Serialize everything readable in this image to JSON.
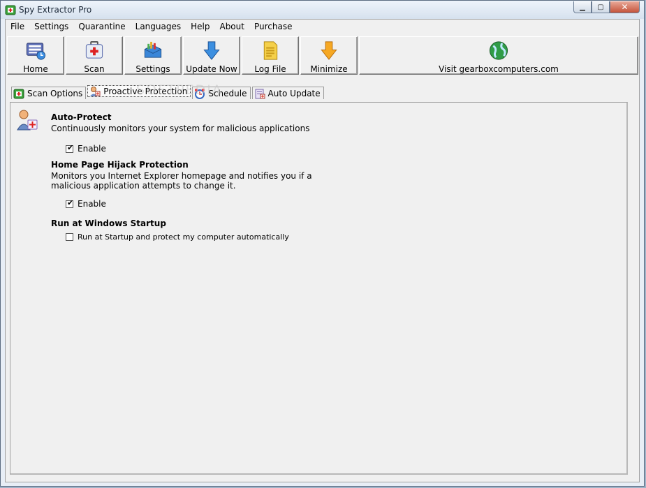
{
  "window": {
    "title": "Spy Extractor Pro",
    "controls": [
      "minimize",
      "maximize",
      "close"
    ]
  },
  "menu": [
    "File",
    "Settings",
    "Quarantine",
    "Languages",
    "Help",
    "About",
    "Purchase"
  ],
  "toolbar": {
    "home": "Home",
    "scan": "Scan",
    "settings": "Settings",
    "update": "Update Now",
    "log": "Log File",
    "minimize": "Minimize",
    "visit": "Visit gearboxcomputers.com"
  },
  "tabs": {
    "scan_options": "Scan Options",
    "proactive": "Proactive Protection",
    "schedule": "Schedule",
    "auto_update": "Auto Update",
    "active": "Proactive Protection"
  },
  "sections": {
    "auto_protect": {
      "title": "Auto-Protect",
      "desc": "Continuously monitors your system for malicious applications",
      "checkbox_label": "Enable",
      "checked": true
    },
    "hijack": {
      "title": "Home Page Hijack Protection",
      "desc_line1": "Monitors you Internet Explorer homepage and notifies you if a",
      "desc_line2": "malicious application attempts to change it.",
      "checkbox_label": "Enable",
      "checked": true
    },
    "startup": {
      "title": "Run at Windows Startup",
      "checkbox_label": "Run at Startup and protect my computer automatically",
      "checked": false
    }
  },
  "watermark": "SOFTPEDIA",
  "colors": {
    "titlebar": "#dbe6f2",
    "close_button": "#c4533a",
    "panel": "#f0f0f0"
  }
}
